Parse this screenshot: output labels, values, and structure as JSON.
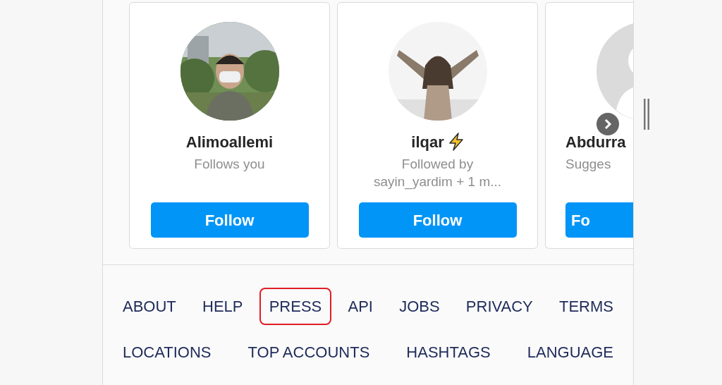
{
  "suggestions": [
    {
      "name": "Alimoallemi",
      "lightning": false,
      "subtitle": [
        "Follows you"
      ],
      "button": "Follow"
    },
    {
      "name": "ilqar",
      "lightning": true,
      "subtitle": [
        "Followed by",
        "sayin_yardim + 1 m..."
      ],
      "button": "Follow"
    },
    {
      "kind": "default",
      "name": "Abdurra",
      "lightning": false,
      "subtitle": [
        "Sugges"
      ],
      "button": "Fo"
    }
  ],
  "footer_links": [
    [
      {
        "label": "ABOUT",
        "circled": false
      },
      {
        "label": "HELP",
        "circled": false
      },
      {
        "label": "PRESS",
        "circled": true
      },
      {
        "label": "API",
        "circled": false
      },
      {
        "label": "JOBS",
        "circled": false
      },
      {
        "label": "PRIVACY",
        "circled": false
      },
      {
        "label": "TERMS",
        "circled": false
      }
    ],
    [
      {
        "label": "LOCATIONS",
        "circled": false
      },
      {
        "label": "TOP ACCOUNTS",
        "circled": false
      },
      {
        "label": "HASHTAGS",
        "circled": false
      },
      {
        "label": "LANGUAGE",
        "circled": false
      }
    ]
  ]
}
